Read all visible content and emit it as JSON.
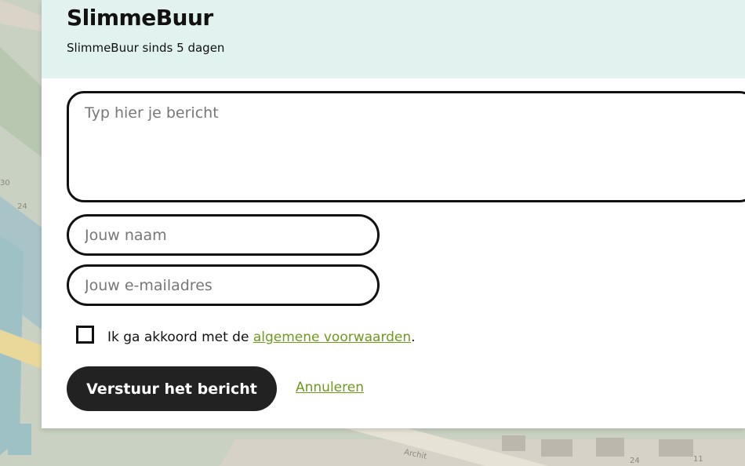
{
  "map": {
    "labels": [
      "30",
      "24",
      "Archit",
      "24",
      "11"
    ]
  },
  "header": {
    "title": "SlimmeBuur",
    "subtitle": "SlimmeBuur sinds 5 dagen"
  },
  "form": {
    "message_placeholder": "Typ hier je bericht",
    "name_placeholder": "Jouw naam",
    "email_placeholder": "Jouw e-mailadres",
    "terms_prefix": "Ik ga akkoord met de ",
    "terms_link": "algemene voorwaarden",
    "terms_suffix": ".",
    "submit_label": "Verstuur het bericht",
    "cancel_label": "Annuleren"
  },
  "colors": {
    "header_bg": "#e1f2ef",
    "button_bg": "#222222",
    "link": "#6f9a1c"
  }
}
